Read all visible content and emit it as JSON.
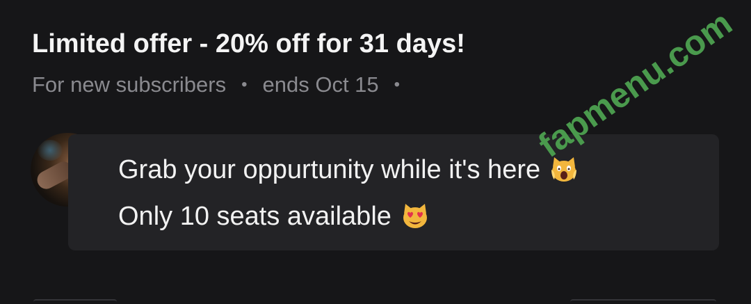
{
  "offer": {
    "title": "Limited offer - 20% off for 31 days!",
    "audience": "For new subscribers",
    "meta_separator": "•",
    "end_text": "ends Oct 15"
  },
  "message": {
    "lines": [
      {
        "text": "Grab your oppurtunity while it's here",
        "emoji_icon": "screaming-cat-face-icon"
      },
      {
        "text": "Only 10 seats available",
        "emoji_icon": "smiling-cat-heart-eyes-icon"
      }
    ]
  },
  "watermark": {
    "text": "fapmenu.com",
    "color": "#4a9a4d"
  },
  "colors": {
    "background": "#161618",
    "bubble": "#232326",
    "muted_text": "#8a8a8f",
    "primary_text": "#f2f2f2"
  }
}
